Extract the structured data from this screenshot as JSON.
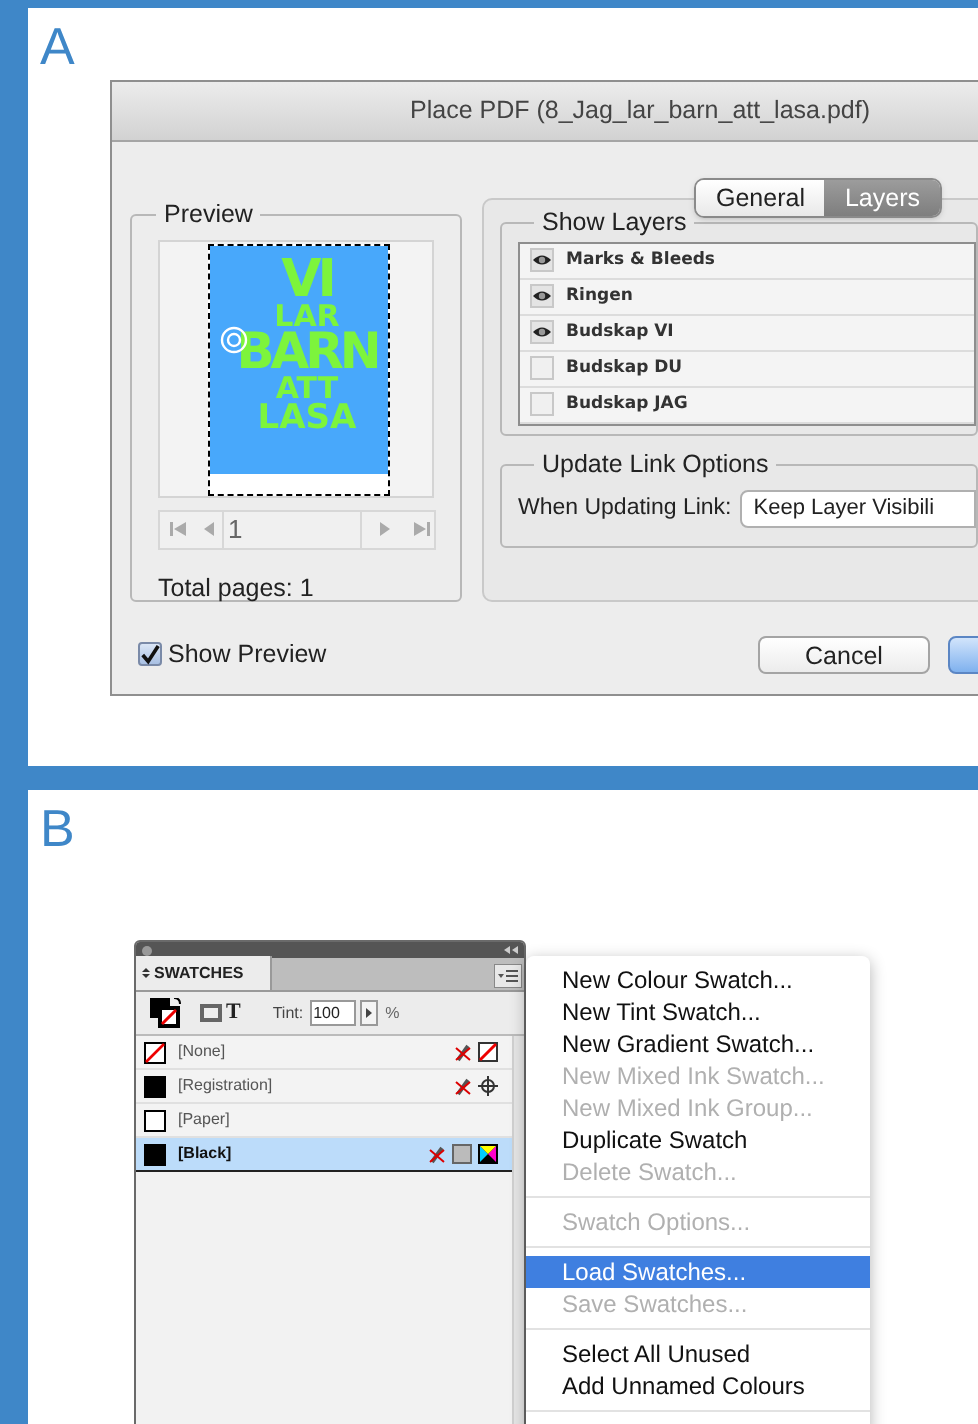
{
  "panel_a": {
    "label": "A",
    "dialog": {
      "title": "Place PDF (8_Jag_lar_barn_att_lasa.pdf)",
      "tabs": [
        {
          "label": "General",
          "selected": false
        },
        {
          "label": "Layers",
          "selected": true
        }
      ],
      "preview": {
        "legend": "Preview",
        "artwork_lines": [
          "VI",
          "LAR",
          "BARN",
          "ATT",
          "LASA"
        ],
        "page_field": "1",
        "total_pages": "Total pages: 1"
      },
      "show_layers": {
        "legend": "Show Layers",
        "layers": [
          {
            "name": "Marks & Bleeds",
            "visible": true
          },
          {
            "name": "Ringen",
            "visible": true
          },
          {
            "name": "Budskap VI",
            "visible": true
          },
          {
            "name": "Budskap DU",
            "visible": false
          },
          {
            "name": "Budskap JAG",
            "visible": false
          }
        ]
      },
      "update_link": {
        "legend": "Update Link Options",
        "label": "When Updating Link:",
        "value": "Keep Layer Visibili"
      },
      "show_preview": {
        "label": "Show Preview",
        "checked": true
      },
      "buttons": [
        {
          "kind": "normal",
          "label": "Cancel"
        },
        {
          "kind": "default"
        }
      ]
    }
  },
  "panel_b": {
    "label": "B",
    "swatches_panel": {
      "tab": "SWATCHES",
      "text_icon": "T",
      "tint_label": "Tint:",
      "tint": "100",
      "percent": "%",
      "swatches": [
        {
          "name": "[None]",
          "kind": "none",
          "selected": false
        },
        {
          "name": "[Registration]",
          "kind": "registration",
          "selected": false
        },
        {
          "name": "[Paper]",
          "kind": "paper",
          "selected": false
        },
        {
          "name": "[Black]",
          "kind": "black",
          "selected": true
        }
      ]
    },
    "menu": [
      {
        "kind": "item",
        "label": "New Colour Swatch...",
        "disabled": false,
        "selected": false
      },
      {
        "kind": "item",
        "label": "New Tint Swatch...",
        "disabled": false,
        "selected": false
      },
      {
        "kind": "item",
        "label": "New Gradient Swatch...",
        "disabled": false,
        "selected": false
      },
      {
        "kind": "item",
        "label": "New Mixed Ink Swatch...",
        "disabled": true,
        "selected": false
      },
      {
        "kind": "item",
        "label": "New Mixed Ink Group...",
        "disabled": true,
        "selected": false
      },
      {
        "kind": "item",
        "label": "Duplicate Swatch",
        "disabled": false,
        "selected": false
      },
      {
        "kind": "item",
        "label": "Delete Swatch...",
        "disabled": true,
        "selected": false
      },
      {
        "kind": "separator"
      },
      {
        "kind": "item",
        "label": "Swatch Options...",
        "disabled": true,
        "selected": false
      },
      {
        "kind": "separator"
      },
      {
        "kind": "item",
        "label": "Load Swatches...",
        "disabled": false,
        "selected": true
      },
      {
        "kind": "item",
        "label": "Save Swatches...",
        "disabled": true,
        "selected": false
      },
      {
        "kind": "separator"
      },
      {
        "kind": "item",
        "label": "Select All Unused",
        "disabled": false,
        "selected": false
      },
      {
        "kind": "item",
        "label": "Add Unnamed Colours",
        "disabled": false,
        "selected": false
      },
      {
        "kind": "separator"
      }
    ]
  }
}
